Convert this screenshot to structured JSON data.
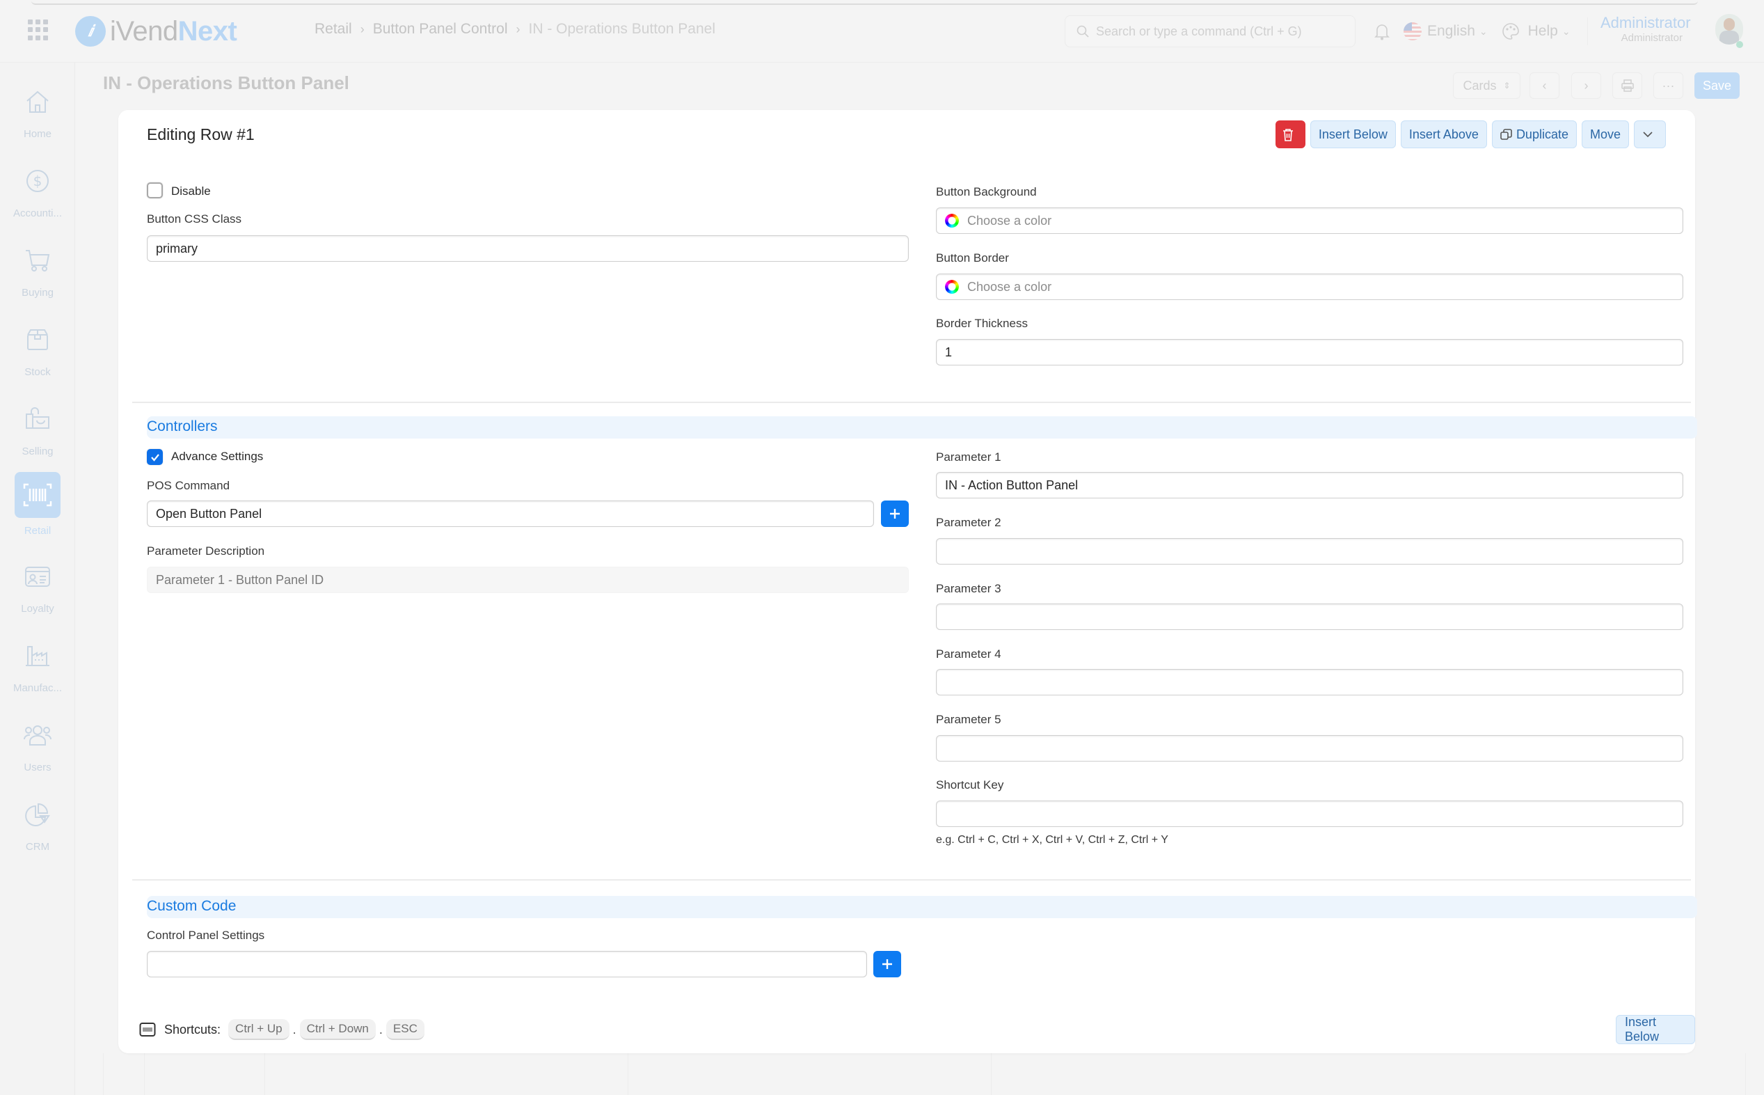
{
  "app": {
    "logo_prefix": "iVend",
    "logo_suffix": "Next",
    "breadcrumb": [
      "Retail",
      "Button Panel Control",
      "IN - Operations Button Panel"
    ],
    "search_placeholder": "Search or type a command (Ctrl + G)",
    "language": "English",
    "help_label": "Help",
    "user_name": "Administrator",
    "user_role": "Administrator"
  },
  "sidebar": {
    "items": [
      {
        "label": "Home",
        "icon": "home-icon"
      },
      {
        "label": "Accounti...",
        "icon": "dollar-icon"
      },
      {
        "label": "Buying",
        "icon": "cart-icon"
      },
      {
        "label": "Stock",
        "icon": "box-icon"
      },
      {
        "label": "Selling",
        "icon": "bag-icon"
      },
      {
        "label": "Retail",
        "icon": "barcode-icon",
        "active": true
      },
      {
        "label": "Loyalty",
        "icon": "id-card-icon"
      },
      {
        "label": "Manufac...",
        "icon": "factory-icon"
      },
      {
        "label": "Users",
        "icon": "users-icon"
      },
      {
        "label": "CRM",
        "icon": "pie-chart-icon"
      }
    ]
  },
  "page": {
    "title": "IN - Operations Button Panel",
    "view_select": "Cards",
    "more_label": "···",
    "save_label": "Save"
  },
  "editor": {
    "title": "Editing Row #1",
    "actions": {
      "insert_below": "Insert Below",
      "insert_above": "Insert Above",
      "duplicate": "Duplicate",
      "move": "Move"
    },
    "disable": {
      "label": "Disable",
      "checked": false
    },
    "button_css_class": {
      "label": "Button CSS Class",
      "value": "primary"
    },
    "button_background": {
      "label": "Button Background",
      "placeholder": "Choose a color",
      "value": ""
    },
    "button_border": {
      "label": "Button Border",
      "placeholder": "Choose a color",
      "value": ""
    },
    "border_thickness": {
      "label": "Border Thickness",
      "value": "1"
    },
    "controllers": {
      "section_title": "Controllers",
      "advance_settings": {
        "label": "Advance Settings",
        "checked": true
      },
      "pos_command": {
        "label": "POS Command",
        "value": "Open Button Panel"
      },
      "parameter_description": {
        "label": "Parameter Description",
        "value": "Parameter 1 - Button Panel ID"
      },
      "parameters": [
        {
          "label": "Parameter 1",
          "value": "IN - Action Button Panel"
        },
        {
          "label": "Parameter 2",
          "value": ""
        },
        {
          "label": "Parameter 3",
          "value": ""
        },
        {
          "label": "Parameter 4",
          "value": ""
        },
        {
          "label": "Parameter 5",
          "value": ""
        }
      ],
      "shortcut_key": {
        "label": "Shortcut Key",
        "value": "",
        "hint": "e.g. Ctrl + C, Ctrl + X, Ctrl + V, Ctrl + Z, Ctrl + Y"
      }
    },
    "custom_code": {
      "section_title": "Custom Code",
      "control_panel_settings": {
        "label": "Control Panel Settings",
        "value": ""
      }
    },
    "footer": {
      "shortcuts_label": "Shortcuts:",
      "keys": [
        "Ctrl + Up",
        "Ctrl + Down",
        "ESC"
      ],
      "separator": ".",
      "insert_below": "Insert Below"
    }
  },
  "colors": {
    "accent": "#0d7bf2",
    "danger": "#e0343a",
    "section_title": "#1a7be0",
    "action_button_bg": "#e3f0fc"
  }
}
